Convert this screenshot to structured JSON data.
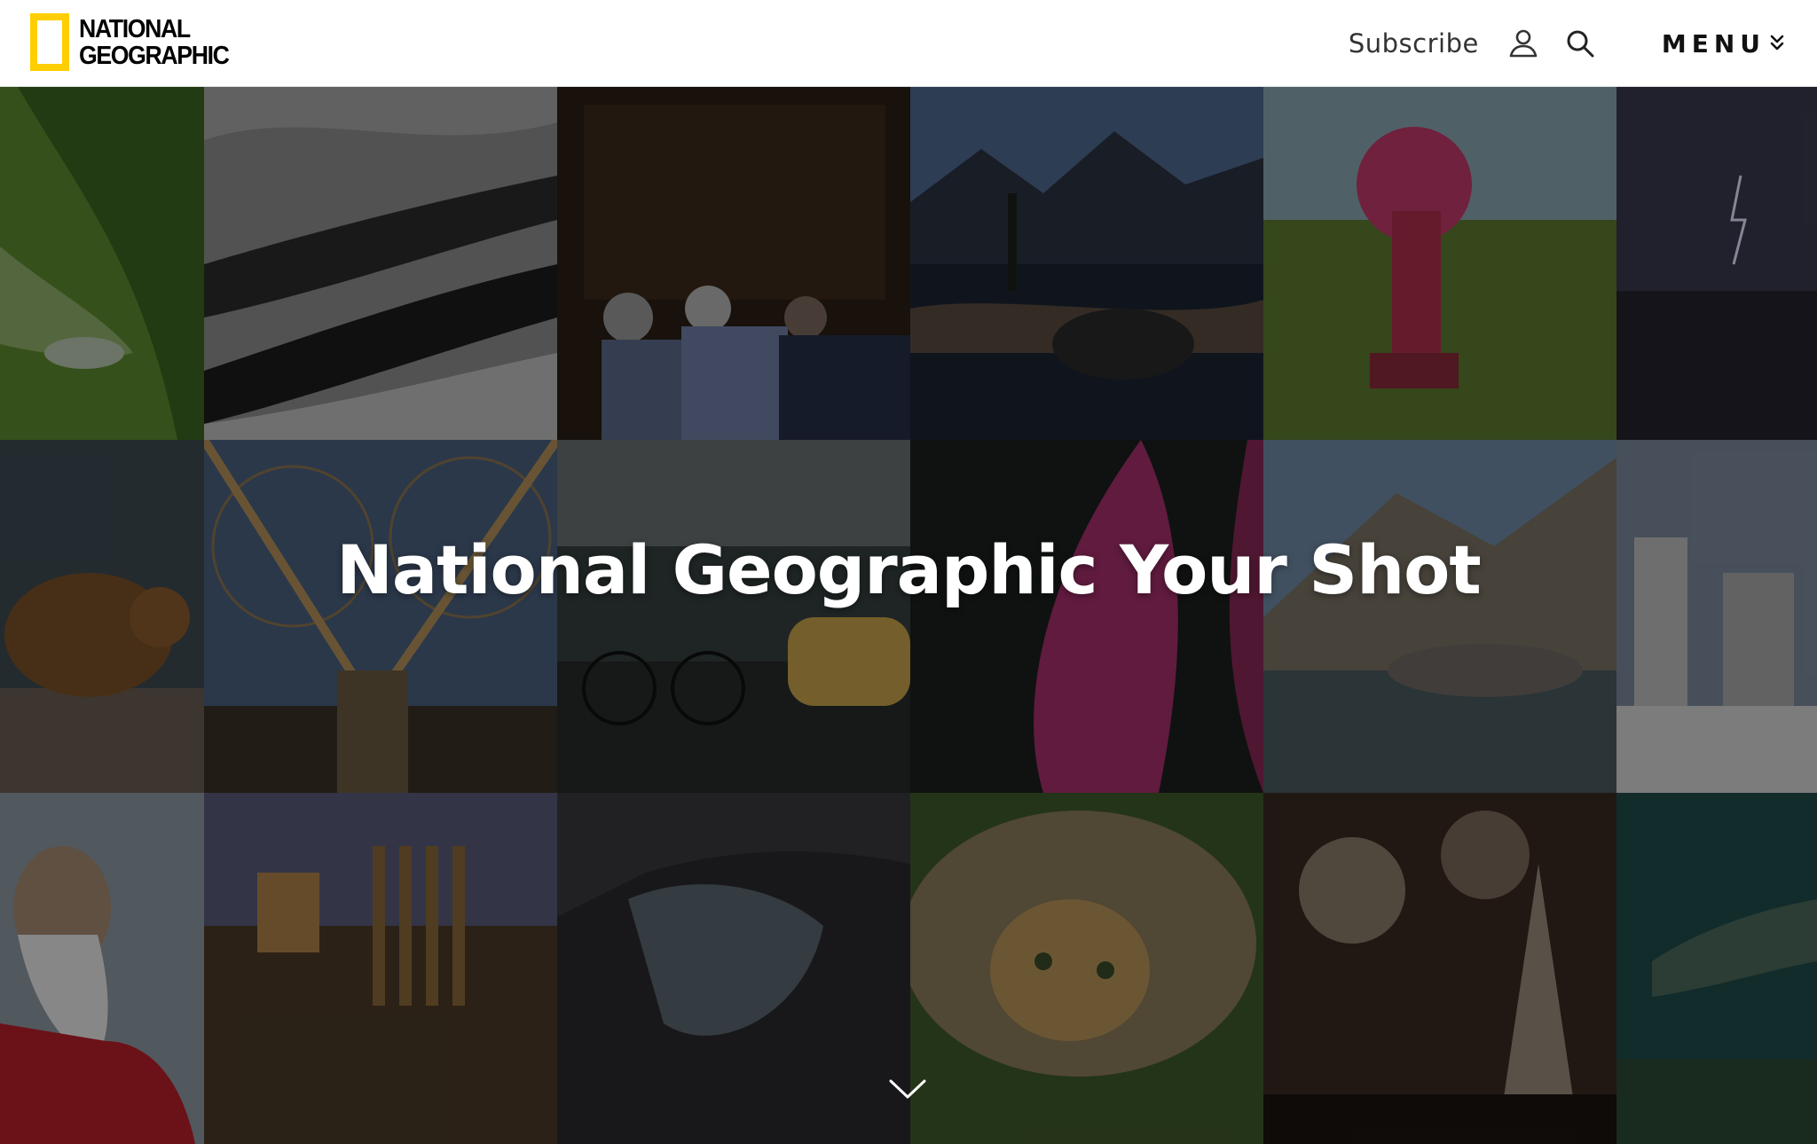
{
  "header": {
    "logo_line1": "NATIONAL",
    "logo_line2": "GEOGRAPHIC",
    "subscribe_label": "Subscribe",
    "user_icon": "user-icon",
    "search_icon": "search-icon",
    "menu_label": "MENU",
    "menu_icon": "chevron-double-down-icon"
  },
  "hero": {
    "title": "National Geographic Your Shot",
    "scroll_icon": "chevron-down-icon"
  },
  "colors": {
    "brand_yellow": "#ffce00",
    "header_bg": "#ffffff",
    "overlay": "rgba(0,0,0,0.42)"
  },
  "photos": [
    "lizard on green leaf",
    "misty forest hills",
    "museum visitors at painting",
    "mountain lake reflection",
    "masked dancer in field",
    "lightning over sea",
    "running bear",
    "bridge cables",
    "rainy street with taxi",
    "pink flower petal",
    "people on rock by mountain river",
    "white rock formations",
    "bearded holy man",
    "ancient roman ruins",
    "canyon river",
    "leopard lying on grass",
    "fireworks over church",
    "crocodile underwater"
  ]
}
